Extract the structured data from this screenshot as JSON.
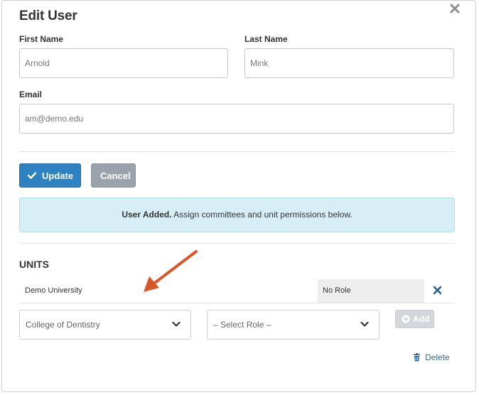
{
  "modal": {
    "title": "Edit User",
    "close_icon": "close-icon"
  },
  "form": {
    "first_name_label": "First Name",
    "first_name_value": "Arnold",
    "last_name_label": "Last Name",
    "last_name_value": "Mink",
    "email_label": "Email",
    "email_value": "am@demo.edu"
  },
  "actions": {
    "update_label": "Update",
    "update_icon": "checkmark-icon",
    "cancel_label": "Cancel"
  },
  "alert": {
    "strong": "User Added.",
    "text": " Assign committees and unit permissions below."
  },
  "units": {
    "heading": "UNITS",
    "rows": [
      {
        "unit": "Demo University",
        "role": "No Role"
      }
    ],
    "unit_select_value": "College of Dentistry",
    "role_select_value": "– Select Role –",
    "add_label": "Add",
    "add_icon": "plus-circle-icon",
    "delete_label": "Delete",
    "delete_icon": "trash-icon"
  },
  "colors": {
    "primary": "#2e82c2",
    "alert_bg": "#d8eef6",
    "annotation_arrow": "#d9562b"
  }
}
